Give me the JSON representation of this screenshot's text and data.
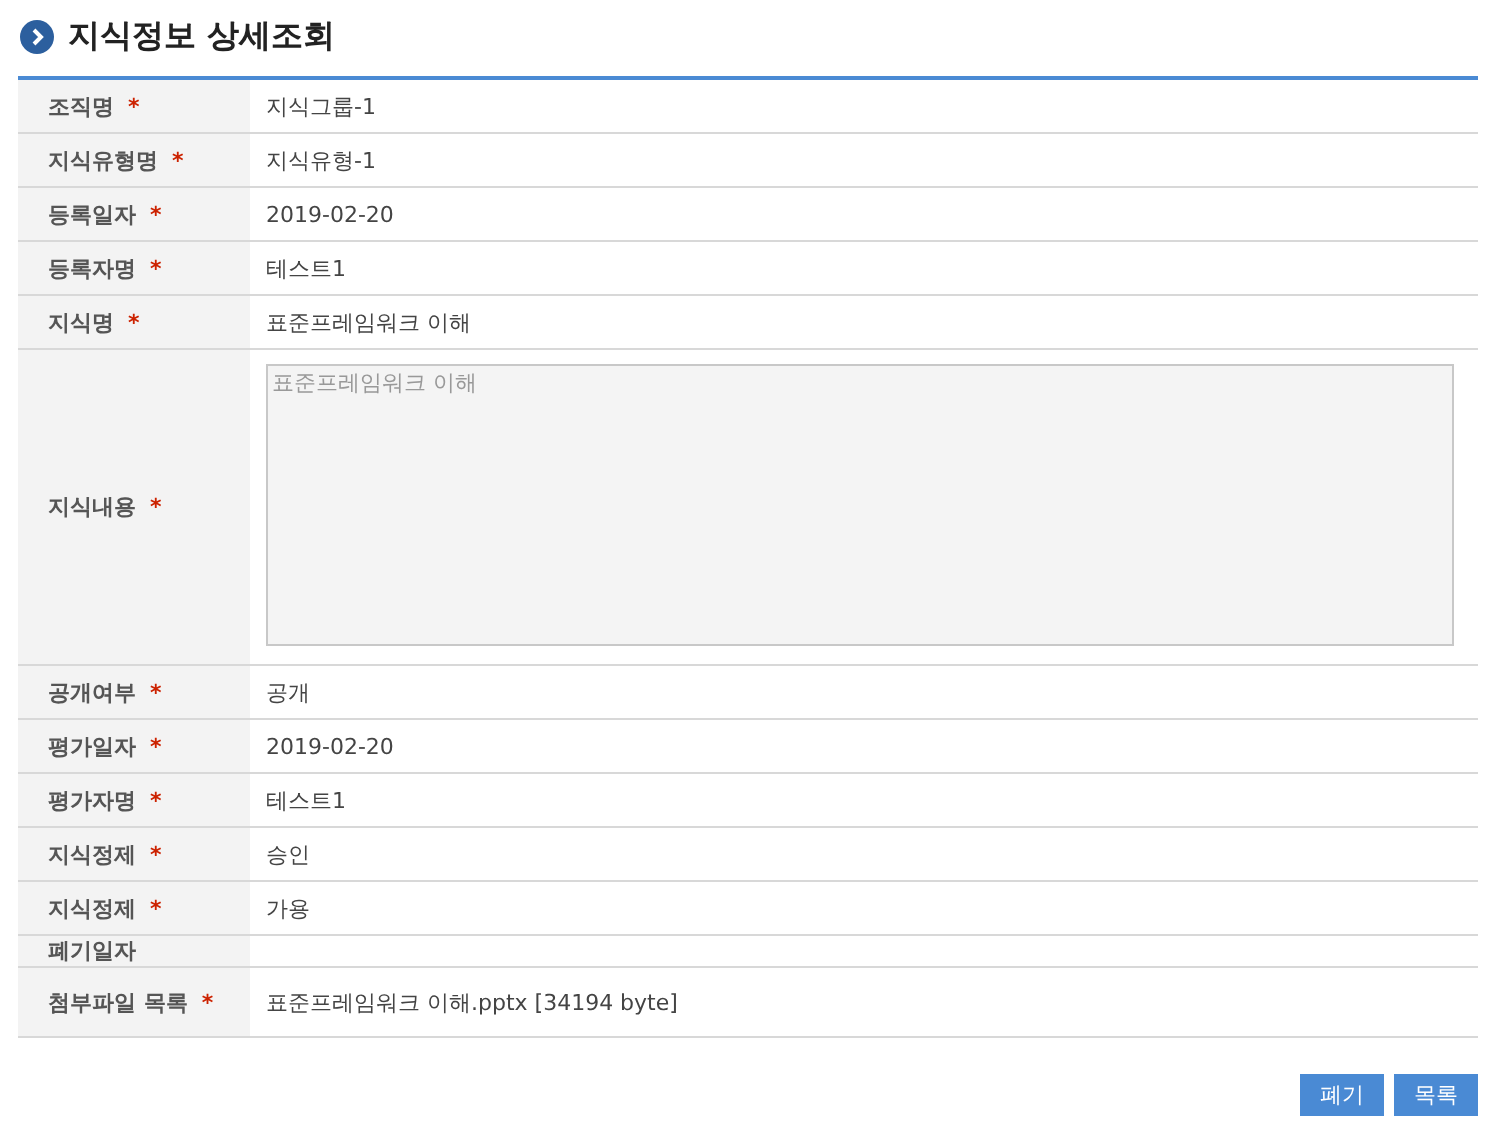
{
  "title": "지식정보 상세조회",
  "rows": [
    {
      "label": "조직명",
      "mark": "*",
      "kind": "text",
      "value": "지식그룹-1"
    },
    {
      "label": "지식유형명",
      "mark": "*",
      "kind": "text",
      "value": "지식유형-1"
    },
    {
      "label": "등록일자",
      "mark": "*",
      "kind": "text",
      "value": "2019-02-20"
    },
    {
      "label": "등록자명",
      "mark": "*",
      "kind": "text",
      "value": "테스트1"
    },
    {
      "label": "지식명",
      "mark": "*",
      "kind": "text",
      "value": "표준프레임워크 이해"
    },
    {
      "label": "지식내용",
      "mark": "*",
      "kind": "textarea",
      "value": "표준프레임워크 이해"
    },
    {
      "label": "공개여부",
      "mark": "*",
      "kind": "text",
      "value": "공개"
    },
    {
      "label": "평가일자",
      "mark": "*",
      "kind": "text",
      "value": "2019-02-20"
    },
    {
      "label": "평가자명",
      "mark": "*",
      "kind": "text",
      "value": "테스트1"
    },
    {
      "label": "지식정제",
      "mark": "*",
      "kind": "text",
      "value": "승인"
    },
    {
      "label": "지식정제",
      "mark": "*",
      "kind": "text",
      "value": "가용"
    },
    {
      "label": "폐기일자",
      "kind": "empty"
    },
    {
      "label": "첨부파일 목록",
      "mark": "*",
      "kind": "file",
      "value": "표준프레임워크 이해.pptx [34194 byte]"
    }
  ],
  "buttons": [
    "폐기",
    "목록"
  ]
}
